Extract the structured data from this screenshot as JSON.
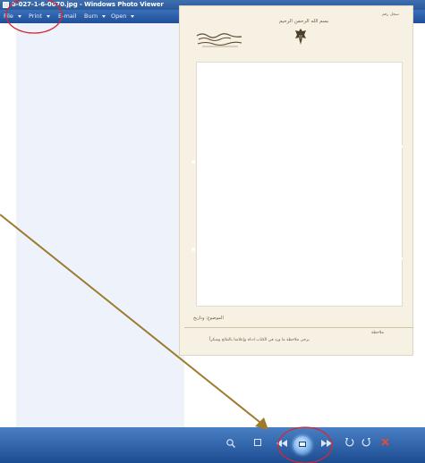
{
  "window": {
    "title": "8-027-1-6-0070.jpg - Windows Photo Viewer"
  },
  "menubar": {
    "items": [
      {
        "label": "File"
      },
      {
        "label": "Print"
      },
      {
        "label": "E-mail"
      },
      {
        "label": "Burn"
      },
      {
        "label": "Open"
      }
    ]
  },
  "document": {
    "ref_text": "سجل رقم",
    "header_center": "بسم الله الرحمن الرحيم",
    "subject_label": "الموضوع: وتاريخ",
    "note_label": "ملاحظة",
    "note_text": "يرجى ملاحظة ما ورد في الكتاب ادناه وإعلامنا بالنتائج وشكراً"
  },
  "toolbar": {
    "buttons": [
      {
        "name": "zoom",
        "icon": "magnifier-icon"
      },
      {
        "name": "fit",
        "icon": "actual-size-icon"
      },
      {
        "name": "previous",
        "icon": "previous-icon"
      },
      {
        "name": "slideshow",
        "icon": "slideshow-icon"
      },
      {
        "name": "next",
        "icon": "next-icon"
      },
      {
        "name": "rotate-left",
        "icon": "rotate-counterclockwise-icon"
      },
      {
        "name": "rotate-right",
        "icon": "rotate-clockwise-icon"
      },
      {
        "name": "delete",
        "icon": "delete-icon"
      }
    ]
  },
  "colors": {
    "titlebar": "#2b5a9a",
    "toolbar": "#1c4c92",
    "annotation_circle": "#d9262c",
    "annotation_arrow": "#a07a2c",
    "paper": "#f7f1e3"
  }
}
